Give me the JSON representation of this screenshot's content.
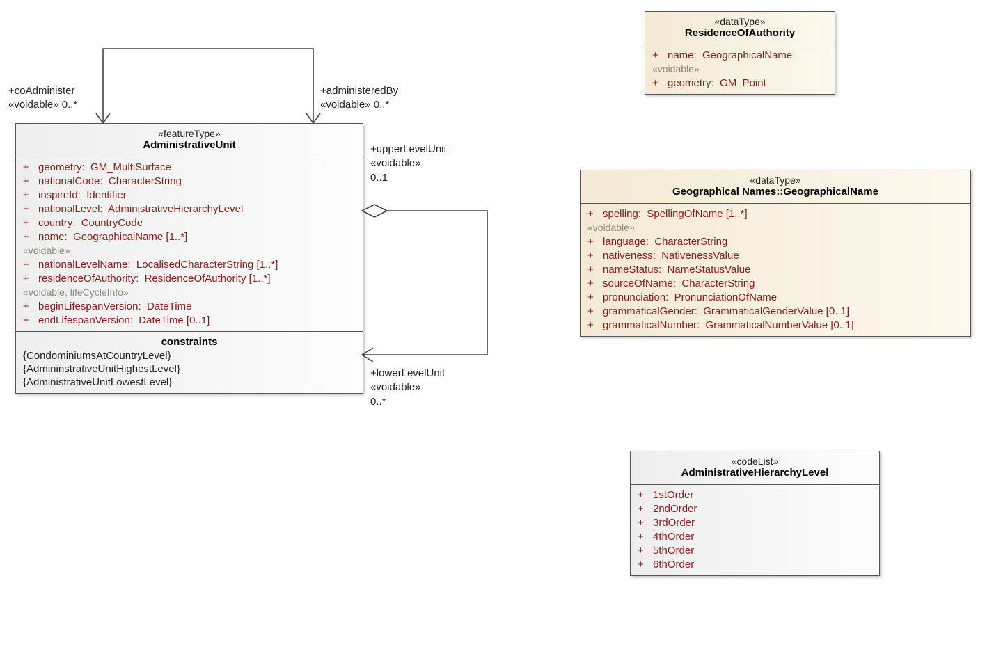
{
  "boxes": {
    "admin_unit": {
      "stereo": "«featureType»",
      "name": "AdministrativeUnit",
      "attrs": [
        {
          "vis": "+",
          "txt": "geometry:  GM_MultiSurface"
        },
        {
          "vis": "+",
          "txt": "nationalCode:  CharacterString"
        },
        {
          "vis": "+",
          "txt": "inspireId:  Identifier"
        },
        {
          "vis": "+",
          "txt": "nationalLevel:  AdministrativeHierarchyLevel"
        },
        {
          "vis": "+",
          "txt": "country:  CountryCode"
        },
        {
          "vis": "+",
          "txt": "name:  GeographicalName [1..*]"
        }
      ],
      "voidable_label": "«voidable»",
      "voidable": [
        {
          "vis": "+",
          "txt": "nationalLevelName:  LocalisedCharacterString [1..*]"
        },
        {
          "vis": "+",
          "txt": "residenceOfAuthority:  ResidenceOfAuthority [1..*]"
        }
      ],
      "lifecycle_label": "«voidable, lifeCycleInfo»",
      "lifecycle": [
        {
          "vis": "+",
          "txt": "beginLifespanVersion:  DateTime"
        },
        {
          "vis": "+",
          "txt": "endLifespanVersion:  DateTime [0..1]"
        }
      ],
      "constraints_title": "constraints",
      "constraints": [
        "{CondominiumsAtCountryLevel}",
        "{AdmininstrativeUnitHighestLevel}",
        "{AdministrativeUnitLowestLevel}"
      ]
    },
    "residence": {
      "stereo": "«dataType»",
      "name": "ResidenceOfAuthority",
      "attrs": [
        {
          "vis": "+",
          "txt": "name:  GeographicalName"
        }
      ],
      "voidable_label": "«voidable»",
      "voidable": [
        {
          "vis": "+",
          "txt": "geometry:  GM_Point"
        }
      ]
    },
    "geoname": {
      "stereo": "«dataType»",
      "name": "Geographical Names::GeographicalName",
      "attrs": [
        {
          "vis": "+",
          "txt": "spelling:  SpellingOfName [1..*]"
        }
      ],
      "voidable_label": "«voidable»",
      "voidable": [
        {
          "vis": "+",
          "txt": "language:  CharacterString"
        },
        {
          "vis": "+",
          "txt": "nativeness:  NativenessValue"
        },
        {
          "vis": "+",
          "txt": "nameStatus:  NameStatusValue"
        },
        {
          "vis": "+",
          "txt": "sourceOfName:  CharacterString"
        },
        {
          "vis": "+",
          "txt": "pronunciation:  PronunciationOfName"
        },
        {
          "vis": "+",
          "txt": "grammaticalGender:  GrammaticalGenderValue [0..1]"
        },
        {
          "vis": "+",
          "txt": "grammaticalNumber:  GrammaticalNumberValue [0..1]"
        }
      ]
    },
    "hierarchy": {
      "stereo": "«codeList»",
      "name": "AdministrativeHierarchyLevel",
      "attrs": [
        {
          "vis": "+",
          "txt": "1stOrder"
        },
        {
          "vis": "+",
          "txt": "2ndOrder"
        },
        {
          "vis": "+",
          "txt": "3rdOrder"
        },
        {
          "vis": "+",
          "txt": "4thOrder"
        },
        {
          "vis": "+",
          "txt": "5thOrder"
        },
        {
          "vis": "+",
          "txt": "6thOrder"
        }
      ]
    }
  },
  "labels": {
    "coAdminister": "+coAdminister\n«voidable» 0..*",
    "administeredBy": "+administeredBy\n«voidable» 0..*",
    "upperLevelUnit": "+upperLevelUnit\n«voidable»\n0..1",
    "lowerLevelUnit": "+lowerLevelUnit\n«voidable»\n0..*"
  }
}
